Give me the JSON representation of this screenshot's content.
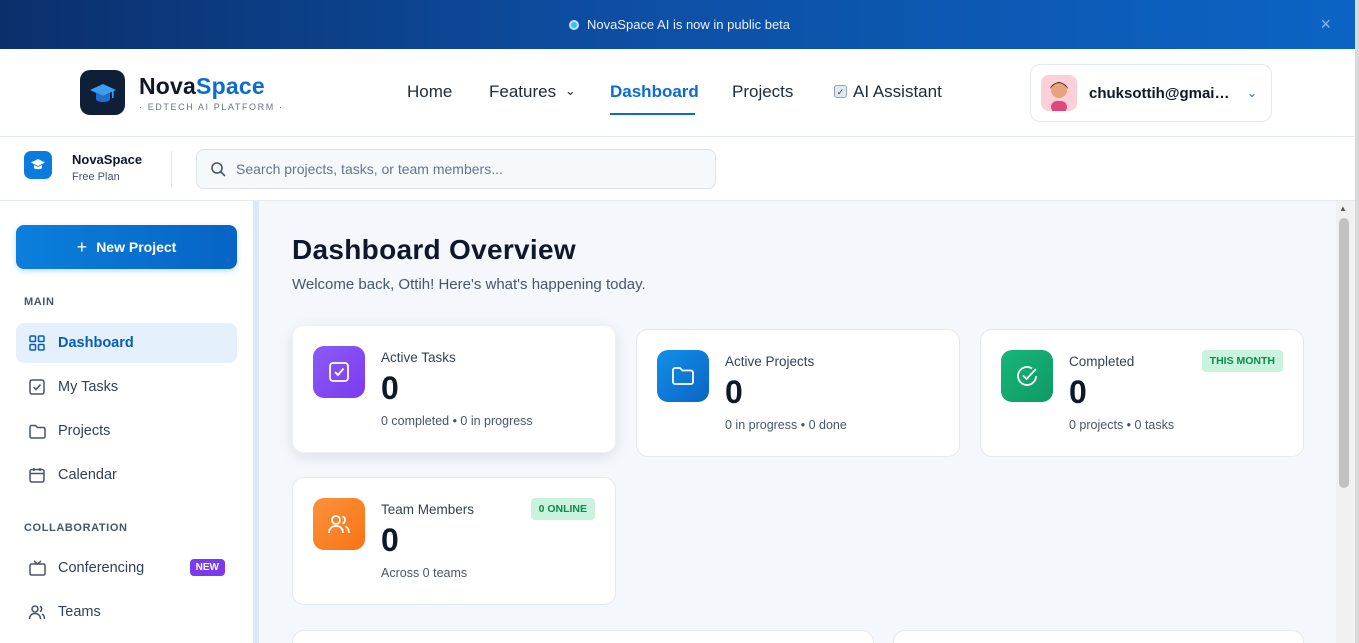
{
  "announcement": {
    "text": "NovaSpace AI is now in public beta",
    "close": "×"
  },
  "brand": {
    "name_part1": "Nova",
    "name_part2": "Space",
    "tagline": "· EDTECH AI PLATFORM ·"
  },
  "nav": {
    "items": [
      {
        "label": "Home"
      },
      {
        "label": "Features",
        "chevron": "⌄"
      },
      {
        "label": "Dashboard"
      },
      {
        "label": "Projects"
      },
      {
        "label": "AI Assistant"
      }
    ],
    "active": "Dashboard"
  },
  "user": {
    "email": "chuksottih@gmail.com",
    "chevron": "⌄"
  },
  "workspace": {
    "name": "NovaSpace",
    "plan": "Free Plan"
  },
  "search": {
    "placeholder": "Search projects, tasks, or team members..."
  },
  "sidebar": {
    "new_project": "New Project",
    "sections": [
      {
        "title": "MAIN",
        "items": [
          "Dashboard",
          "My Tasks",
          "Projects",
          "Calendar"
        ]
      },
      {
        "title": "COLLABORATION",
        "items": [
          "Conferencing",
          "Teams"
        ]
      }
    ],
    "new_badge": "NEW",
    "active_item": "Dashboard"
  },
  "main": {
    "title": "Dashboard Overview",
    "subtitle": "Welcome back, Ottih! Here's what's happening today.",
    "cards": [
      {
        "label": "Active Tasks",
        "value": "0",
        "meta": "0 completed • 0 in progress",
        "color": "#7c4dff"
      },
      {
        "label": "Active Projects",
        "value": "0",
        "meta": "0 in progress • 0 done",
        "color": "#0a74d6"
      },
      {
        "label": "Completed",
        "value": "0",
        "meta": "0 projects • 0 tasks",
        "pill": "THIS MONTH",
        "color": "#12a86b"
      },
      {
        "label": "Team Members",
        "value": "0",
        "meta": "Across 0 teams",
        "pill": "0 ONLINE",
        "color": "#f97316"
      }
    ]
  },
  "colors": {
    "accent": "#0a6cd1",
    "banner": "#0d4ea3",
    "sidebar_active": "#e4f0fb",
    "badge_new": "#7c3aed"
  }
}
